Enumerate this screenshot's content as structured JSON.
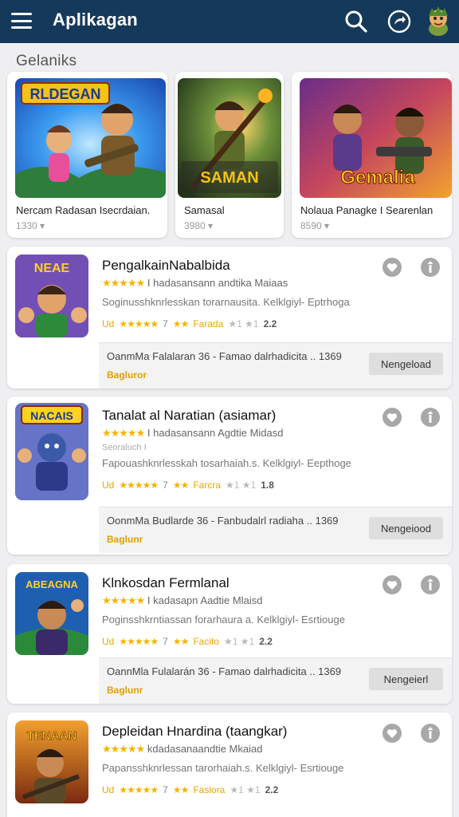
{
  "header": {
    "title": "Aplikagan",
    "icons": [
      "menu-icon",
      "search-icon",
      "share-icon",
      "avatar"
    ]
  },
  "featured": {
    "section_title": "Gelaniks",
    "cards": [
      {
        "name": "Nercam Radasan Isecrdaian.",
        "meta": "1330 ▾",
        "art_text": "RLDEGAN"
      },
      {
        "name": "Samasal",
        "meta": "3980 ▾",
        "art_text": "SAMAN"
      },
      {
        "name": "Nolaua Panagke I Searenlan",
        "meta": "8590 ▾",
        "art_text": "Gemalia"
      }
    ]
  },
  "apps": [
    {
      "name": "PengalkainNabalbida",
      "rating_stars": "★★★★★",
      "rating_text": "I hadasansann andtika Maiaas",
      "sub": "",
      "desc": "Soginusshknrlesskan torarnausita. Kelklgiyl- Eptrhoga",
      "meta_gold": "Ud",
      "meta_stars": "★★★★★",
      "meta_num1": "7",
      "meta_stars2": "★★",
      "meta_label": "Farada",
      "meta_x": "★1 ★1",
      "meta_score": "2.2",
      "promo_text": "OanmMa Falalaran 36 - Famao dalrhadicita .. 1369",
      "promo_badge": "Bagluror",
      "button": "Nengeload",
      "art_text": "NEAE"
    },
    {
      "name": "Tanalat al Naratian (asiamar)",
      "rating_stars": "★★★★★",
      "rating_text": "I hadasansann Agdtie Midasd",
      "sub": "Seoraluch I",
      "desc": "Fapouashknrlesskah tosarhaiah.s. Kelklgiyl- Eepthoge",
      "meta_gold": "Ud",
      "meta_stars": "★★★★★",
      "meta_num1": "7",
      "meta_stars2": "★★",
      "meta_label": "Farcra",
      "meta_x": "★1 ★1",
      "meta_score": "1.8",
      "promo_text": "OonmMa Budlarde 36 - Fanbudalrl radiaha .. 1369",
      "promo_badge": "Baglunr",
      "button": "Nengeiood",
      "art_text": "NACAIS"
    },
    {
      "name": "Klnkosdan Fermlanal",
      "rating_stars": "★★★★★",
      "rating_text": "I kadasapn Aadtie Mlaisd",
      "sub": "",
      "desc": "Poginsshkrntiassan forarhaura a. Kelklgiyl- Esrtiouge",
      "meta_gold": "Ud",
      "meta_stars": "★★★★★",
      "meta_num1": "7",
      "meta_stars2": "★★",
      "meta_label": "Facito",
      "meta_x": "★1 ★1",
      "meta_score": "2.2",
      "promo_text": "OannMla Fulalarán 36 - Famao dalrhadicita .. 1369",
      "promo_badge": "Baglunr",
      "button": "Nengeierl",
      "art_text": "ABEAGNA"
    },
    {
      "name": "Depleidan Hnardina (taangkar)",
      "rating_stars": "★★★★★",
      "rating_text": "kdadasanaandtie Mkaiad",
      "sub": "",
      "desc": "Papansshknrlessan tarorhaiah.s. Kelklgiyl- Esrtiouge",
      "meta_gold": "Ud",
      "meta_stars": "★★★★★",
      "meta_num1": "7",
      "meta_stars2": "★★",
      "meta_label": "Faslora",
      "meta_x": "★1 ★1",
      "meta_score": "2.2",
      "promo_text": "",
      "promo_badge": "",
      "button": "",
      "art_text": "TENAAN"
    }
  ],
  "colors": {
    "topbar": "#15395b",
    "background": "#efeff1",
    "star": "#f5b400",
    "badge": "#e0a000"
  }
}
